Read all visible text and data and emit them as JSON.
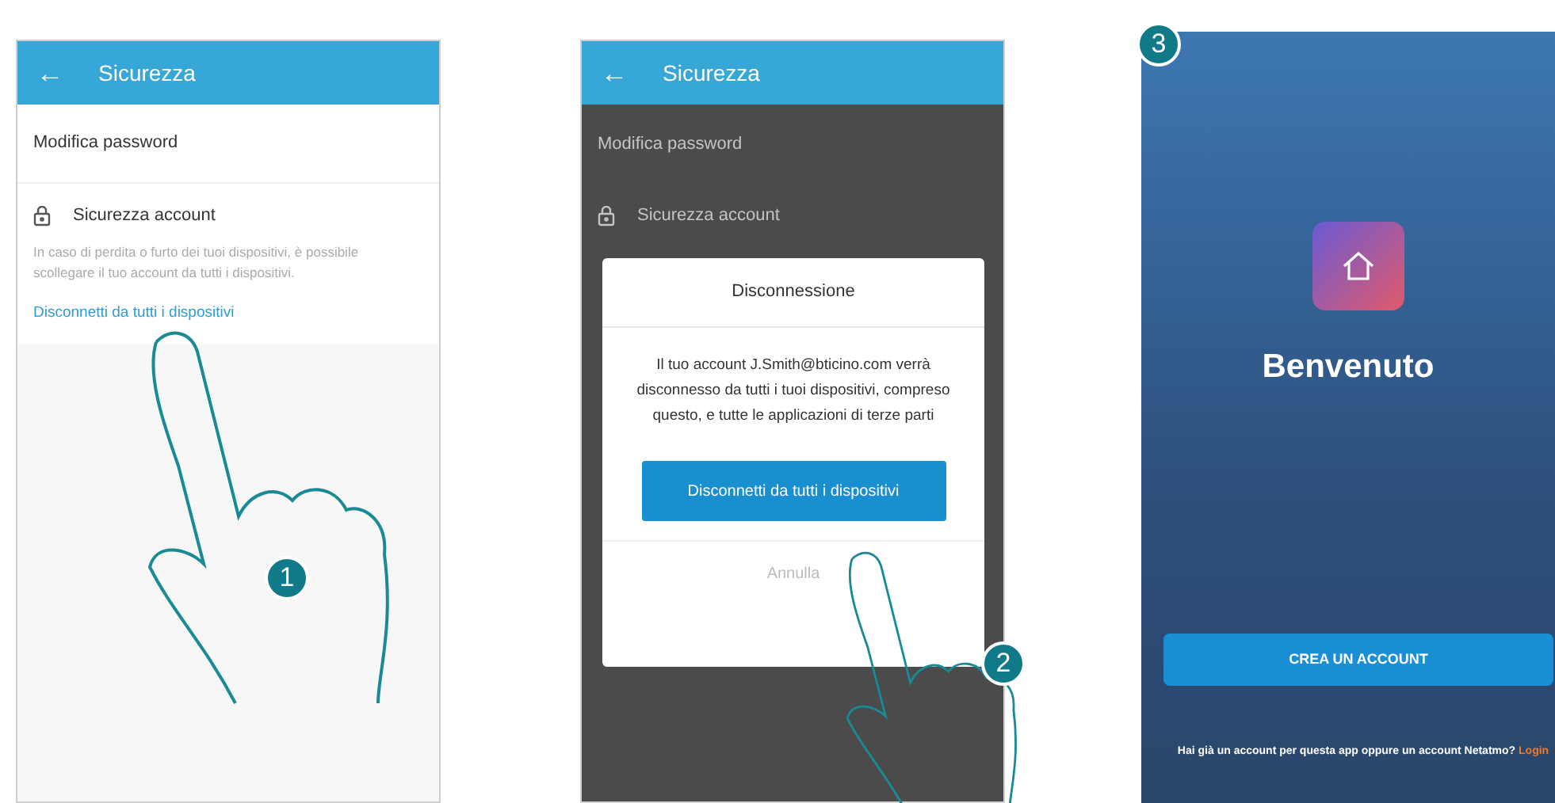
{
  "panels": [
    {
      "kind": "settings",
      "badge": "1",
      "header": {
        "back": "←",
        "title": "Sicurezza"
      },
      "items": [
        "Modifica password"
      ],
      "section": {
        "title": "Sicurezza account",
        "description": "In caso di perdita o furto dei tuoi dispositivi, è possibile scollegare il tuo account da tutti i dispositivi.",
        "link": "Disconnetti da tutti i dispositivi"
      }
    },
    {
      "kind": "dialog",
      "badge": "2",
      "header": {
        "back": "←",
        "title": "Sicurezza"
      },
      "items": [
        "Modifica password"
      ],
      "section": {
        "title": "Sicurezza account"
      },
      "dialog": {
        "title": "Disconnessione",
        "message": "Il tuo account J.Smith@bticino.com verrà disconnesso da tutti i tuoi dispositivi, compreso questo, e tutte le applicazioni di terze parti",
        "confirm": "Disconnetti da tutti i dispositivi",
        "cancel": "Annulla"
      }
    },
    {
      "kind": "welcome",
      "badge": "3",
      "title": "Benvenuto",
      "button": "CREA UN ACCOUNT",
      "footer": "Hai già un account per questa app oppure un account Netatmo?",
      "footer_link": "Login"
    }
  ]
}
